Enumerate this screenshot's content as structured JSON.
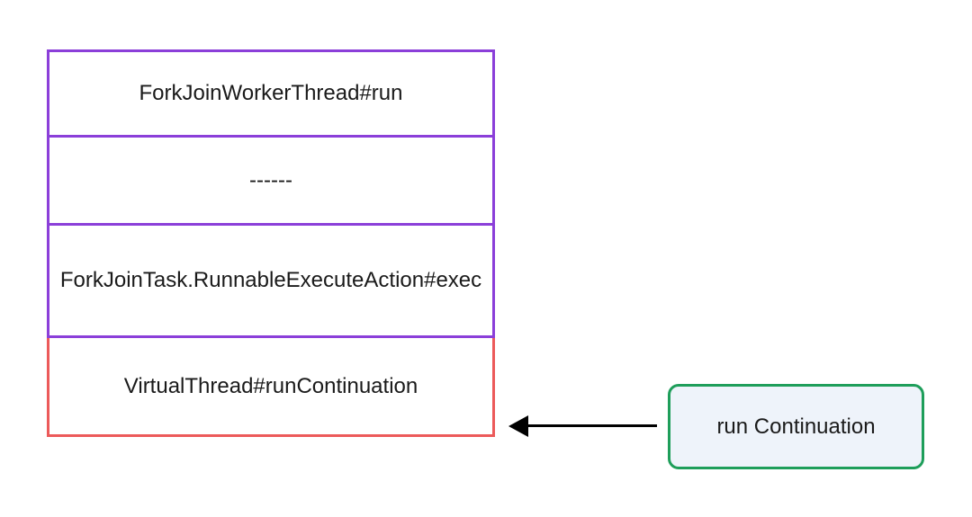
{
  "stack": {
    "items": [
      {
        "label": "ForkJoinWorkerThread#run"
      },
      {
        "label": "------"
      },
      {
        "label": "ForkJoinTask.RunnableExecuteAction#exec"
      },
      {
        "label": "VirtualThread#runContinuation"
      }
    ]
  },
  "side_box": {
    "label": "run Continuation"
  },
  "colors": {
    "stack_border": "#8b3fd9",
    "last_border": "#ec5a5a",
    "side_border": "#1e9e5a",
    "side_fill": "#eef3fa",
    "arrow": "#000000"
  }
}
